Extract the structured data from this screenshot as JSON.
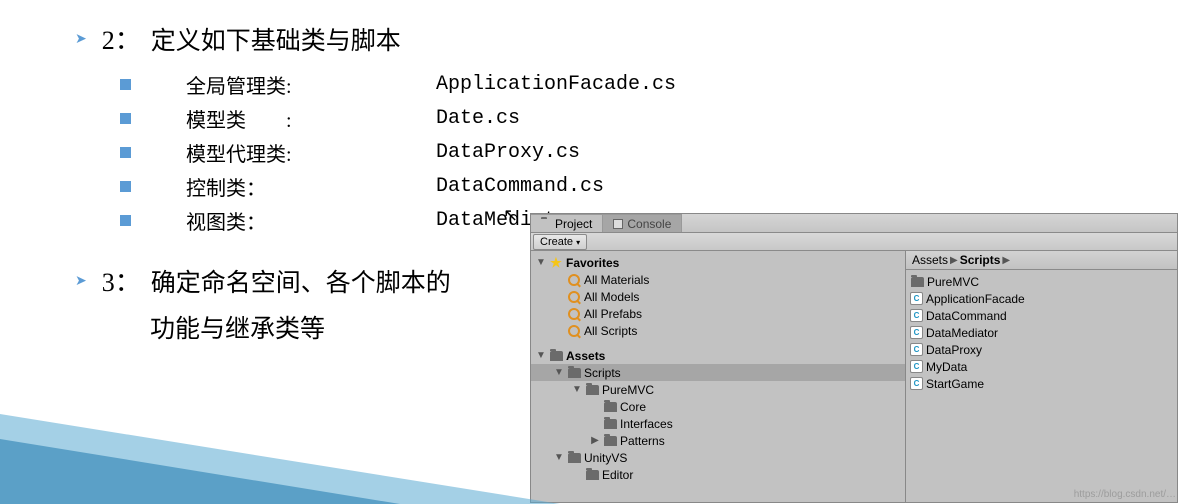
{
  "section2": {
    "number": "2：",
    "title": "定义如下基础类与脚本",
    "rows": [
      {
        "label": "全局管理类:",
        "file": "ApplicationFacade.cs"
      },
      {
        "label": "模型类　　:",
        "file": "Date.cs"
      },
      {
        "label": "模型代理类:",
        "file": "DataProxy.cs"
      },
      {
        "label": "控制类：",
        "file": "DataCommand.cs"
      },
      {
        "label": "视图类：",
        "file": "DataMediator.cs"
      }
    ]
  },
  "section3": {
    "number": "3：",
    "title": "确定命名空间、各个脚本的",
    "desc": "功能与继承类等"
  },
  "unity": {
    "tabs": {
      "project": "Project",
      "console": "Console"
    },
    "create": "Create",
    "favorites": {
      "header": "Favorites",
      "items": [
        "All Materials",
        "All Models",
        "All Prefabs",
        "All Scripts"
      ]
    },
    "assets": {
      "header": "Assets",
      "scripts": "Scripts",
      "puremvc": "PureMVC",
      "core": "Core",
      "interfaces": "Interfaces",
      "patterns": "Patterns",
      "unityvs": "UnityVS",
      "editor": "Editor"
    },
    "breadcrumb": {
      "assets": "Assets",
      "scripts": "Scripts"
    },
    "rightList": [
      {
        "type": "folder",
        "name": "PureMVC"
      },
      {
        "type": "cs",
        "name": "ApplicationFacade"
      },
      {
        "type": "cs",
        "name": "DataCommand"
      },
      {
        "type": "cs",
        "name": "DataMediator"
      },
      {
        "type": "cs",
        "name": "DataProxy"
      },
      {
        "type": "cs",
        "name": "MyData"
      },
      {
        "type": "cs",
        "name": "StartGame"
      }
    ]
  },
  "watermark": "https://blog.csdn.net/…"
}
